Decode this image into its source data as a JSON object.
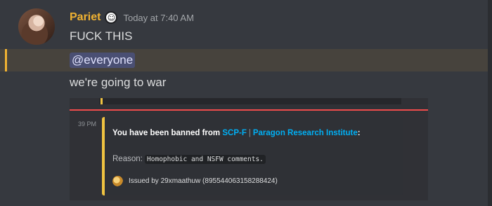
{
  "message": {
    "username": "Pariet",
    "badge_icon": "bot-badge-icon",
    "timestamp": "Today at 7:40 AM",
    "lines": [
      "FUCK THIS",
      "@everyone",
      "we're going to war"
    ],
    "colors": {
      "username": "#f0b232",
      "mention_highlight": "#47433d",
      "mention_bar": "#f0b232",
      "mention_pill": "#4a4f73"
    }
  },
  "attachment": {
    "time_fragment": "39 PM",
    "embed": {
      "title_prefix": "You have been banned from ",
      "server_link_1": "SCP-F",
      "separator": "|",
      "server_link_2": "Paragon Research Institute",
      "title_suffix": ":",
      "reason_label": "Reason: ",
      "reason_code": "Homophobic and NSFW comments.",
      "footer_text": "Issued by 29xmaathuw (895544063158288424)",
      "colors": {
        "accent": "#f0c341",
        "link": "#00aff4",
        "divider": "#ef4c4c"
      }
    }
  }
}
